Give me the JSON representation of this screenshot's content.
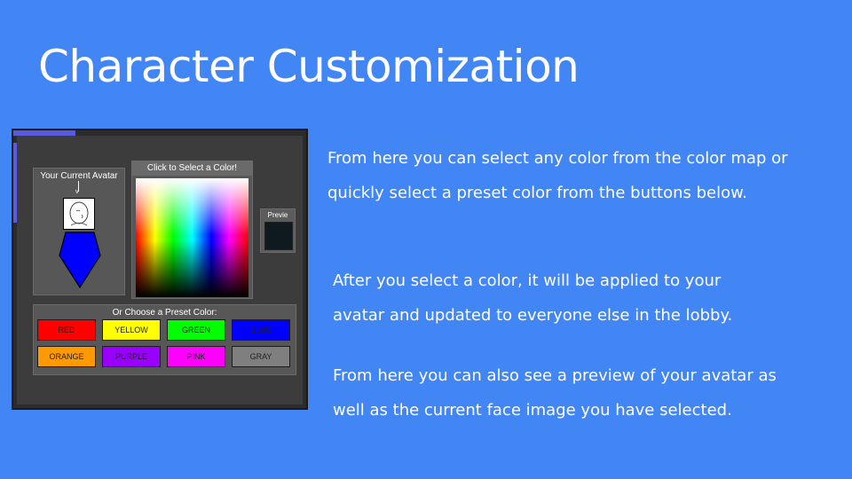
{
  "slide": {
    "title": "Character Customization",
    "paragraphs": [
      "From here you can select any color from the color map or quickly select a preset color from the buttons below.",
      "After you select a color, it will be applied to your avatar and updated to everyone else in the lobby.",
      "From here you can also see a preview of your avatar as well as the current face image you have selected."
    ],
    "background_color": "#4285f4"
  },
  "game_ui": {
    "avatar_panel_label": "Your Current Avatar",
    "avatar_color": "#0000ff",
    "color_picker_label": "Click to Select a Color!",
    "preview_label": "Previe",
    "preview_color": "#0f1a1f",
    "preset_label": "Or Choose a Preset Color:",
    "presets": [
      {
        "label": "RED",
        "color": "#ff0000"
      },
      {
        "label": "YELLOW",
        "color": "#ffff00"
      },
      {
        "label": "GREEN",
        "color": "#00ff00"
      },
      {
        "label": "BLUE",
        "color": "#0000ff"
      },
      {
        "label": "ORANGE",
        "color": "#ff9900"
      },
      {
        "label": "PURPLE",
        "color": "#9900ff"
      },
      {
        "label": "PINK",
        "color": "#ff00ff"
      },
      {
        "label": "GRAY",
        "color": "#7f7f7f"
      }
    ]
  }
}
